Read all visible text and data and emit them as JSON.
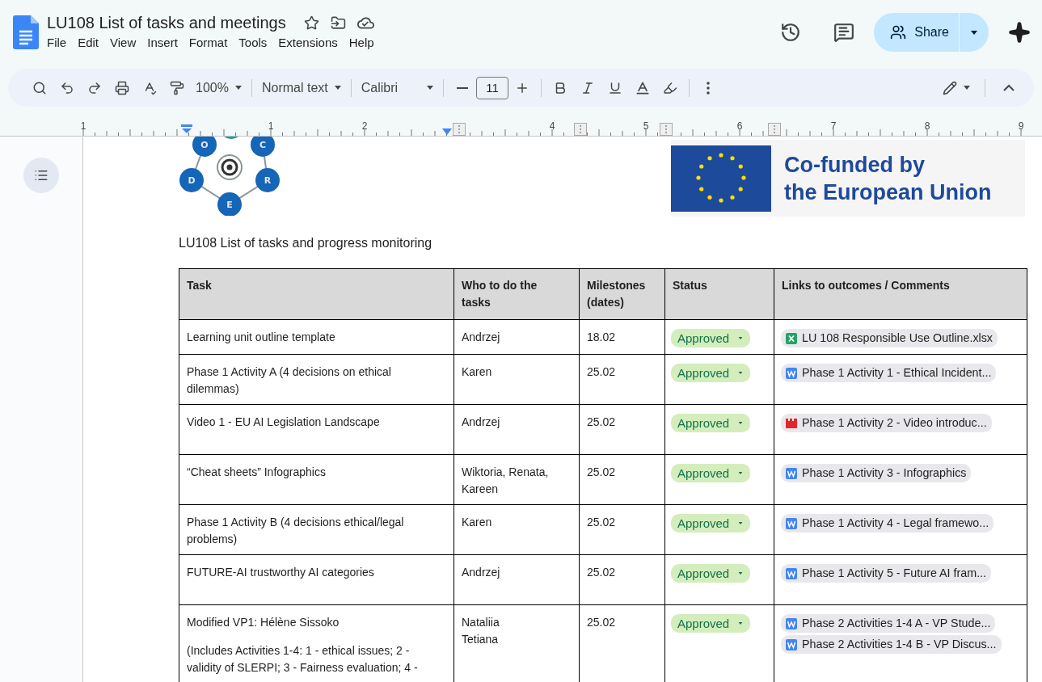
{
  "document_title": "LU108 List of tasks and meetings",
  "menu": [
    "File",
    "Edit",
    "View",
    "Insert",
    "Format",
    "Tools",
    "Extensions",
    "Help"
  ],
  "toolbar": {
    "zoom": "100%",
    "style": "Normal text",
    "font": "Calibri",
    "font_size": "11"
  },
  "share": "Share",
  "ruler": [
    "1",
    "1",
    "2",
    "4",
    "5",
    "6",
    "7",
    "8",
    "9"
  ],
  "logo_letters": [
    "O",
    "C",
    "D",
    "R",
    "E"
  ],
  "eu_banner": [
    "Co-funded by",
    "the European Union"
  ],
  "heading": "LU108 List of tasks and progress monitoring",
  "table": {
    "columns": [
      "Task",
      "Who to do the tasks",
      "Milestones (dates)",
      "Status",
      "Links to outcomes / Comments"
    ],
    "rows": [
      {
        "task": [
          "Learning unit outline template"
        ],
        "who": [
          "Andrzej"
        ],
        "milestone": "18.02",
        "status": "Approved",
        "links": [
          {
            "kind": "sheet",
            "title": "LU 108 Responsible Use Outline.xlsx"
          }
        ]
      },
      {
        "task": [
          "Phase 1 Activity A (4 decisions on ethical dilemmas)"
        ],
        "who": [
          "Karen"
        ],
        "milestone": "25.02",
        "status": "Approved",
        "links": [
          {
            "kind": "doc",
            "title": "Phase 1 Activity 1 - Ethical Incident..."
          }
        ]
      },
      {
        "task": [
          "Video 1 - EU AI Legislation Landscape"
        ],
        "who": [
          "Andrzej"
        ],
        "milestone": "25.02",
        "status": "Approved",
        "links": [
          {
            "kind": "video",
            "title": "Phase 1 Activity 2 - Video introduc..."
          }
        ]
      },
      {
        "task": [
          "“Cheat sheets” Infographics"
        ],
        "who": [
          "Wiktoria, Renata, Kareen"
        ],
        "milestone": "25.02",
        "status": "Approved",
        "links": [
          {
            "kind": "doc",
            "title": "Phase 1 Activity 3 - Infographics"
          }
        ]
      },
      {
        "task": [
          "Phase 1 Activity B (4 decisions ethical/legal problems)"
        ],
        "who": [
          "Karen"
        ],
        "milestone": "25.02",
        "status": "Approved",
        "links": [
          {
            "kind": "doc",
            "title": "Phase 1 Activity 4 - Legal framewo..."
          }
        ]
      },
      {
        "task": [
          "FUTURE-AI trustworthy AI categories"
        ],
        "who": [
          "Andrzej"
        ],
        "milestone": "25.02",
        "status": "Approved",
        "links": [
          {
            "kind": "doc",
            "title": "Phase 1 Activity 5 - Future AI fram..."
          }
        ]
      },
      {
        "task": [
          "Modified VP1: Hélène Sissoko",
          "(Includes Activities 1-4: 1 - ethical issues; 2 - validity of SLERPI; 3 - Fairness evaluation; 4 -"
        ],
        "who": [
          "Nataliia",
          "Tetiana"
        ],
        "milestone": "25.02",
        "status": "Approved",
        "links": [
          {
            "kind": "doc",
            "title": "Phase 2 Activities 1-4 A - VP Stude..."
          },
          {
            "kind": "doc",
            "title": "Phase 2 Activities 1-4 B - VP Discus..."
          }
        ]
      }
    ]
  }
}
